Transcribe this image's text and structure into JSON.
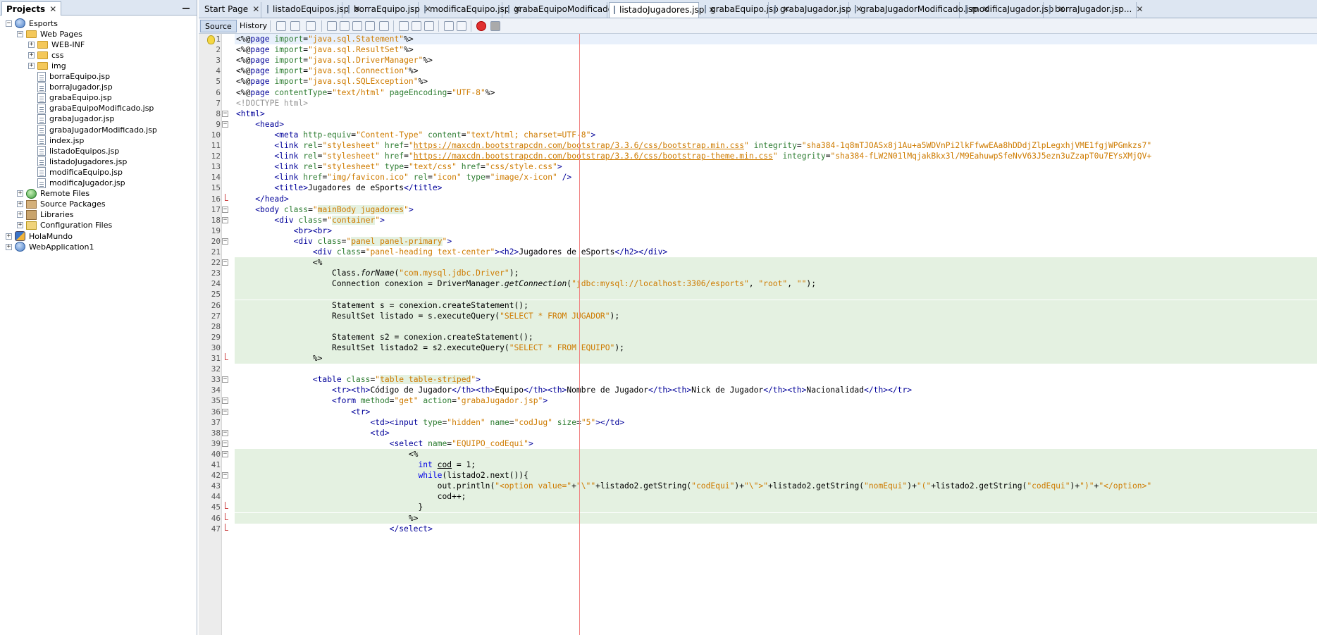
{
  "projects": {
    "tab_label": "Projects",
    "tree": [
      {
        "label": "Esports",
        "icon": "globe-icon",
        "exp": "−",
        "depth": 0
      },
      {
        "label": "Web Pages",
        "icon": "folder-icon",
        "exp": "−",
        "depth": 1
      },
      {
        "label": "WEB-INF",
        "icon": "folder-icon",
        "exp": "+",
        "depth": 2
      },
      {
        "label": "css",
        "icon": "folder-icon",
        "exp": "+",
        "depth": 2
      },
      {
        "label": "img",
        "icon": "folder-icon",
        "exp": "+",
        "depth": 2
      },
      {
        "label": "borraEquipo.jsp",
        "icon": "file-icon",
        "exp": "",
        "depth": 2
      },
      {
        "label": "borraJugador.jsp",
        "icon": "file-icon",
        "exp": "",
        "depth": 2
      },
      {
        "label": "grabaEquipo.jsp",
        "icon": "file-icon",
        "exp": "",
        "depth": 2
      },
      {
        "label": "grabaEquipoModificado.jsp",
        "icon": "file-icon",
        "exp": "",
        "depth": 2
      },
      {
        "label": "grabaJugador.jsp",
        "icon": "file-icon",
        "exp": "",
        "depth": 2
      },
      {
        "label": "grabaJugadorModificado.jsp",
        "icon": "file-icon",
        "exp": "",
        "depth": 2
      },
      {
        "label": "index.jsp",
        "icon": "file-icon",
        "exp": "",
        "depth": 2
      },
      {
        "label": "listadoEquipos.jsp",
        "icon": "file-icon",
        "exp": "",
        "depth": 2
      },
      {
        "label": "listadoJugadores.jsp",
        "icon": "file-icon",
        "exp": "",
        "depth": 2
      },
      {
        "label": "modificaEquipo.jsp",
        "icon": "file-icon",
        "exp": "",
        "depth": 2
      },
      {
        "label": "modificaJugador.jsp",
        "icon": "file-icon",
        "exp": "",
        "depth": 2
      },
      {
        "label": "Remote Files",
        "icon": "remote-globe-icon",
        "exp": "+",
        "depth": 1
      },
      {
        "label": "Source Packages",
        "icon": "package-icon",
        "exp": "+",
        "depth": 1
      },
      {
        "label": "Libraries",
        "icon": "library-icon",
        "exp": "+",
        "depth": 1
      },
      {
        "label": "Configuration Files",
        "icon": "config-folder-icon",
        "exp": "+",
        "depth": 1
      },
      {
        "label": "HolaMundo",
        "icon": "java-project-icon",
        "exp": "+",
        "depth": 0
      },
      {
        "label": "WebApplication1",
        "icon": "globe-icon",
        "exp": "+",
        "depth": 0
      }
    ]
  },
  "editor_tabs": [
    {
      "label": "Start Page",
      "active": false
    },
    {
      "label": "listadoEquipos.jsp",
      "active": false
    },
    {
      "label": "borraEquipo.jsp",
      "active": false
    },
    {
      "label": "modificaEquipo.jsp",
      "active": false
    },
    {
      "label": "grabaEquipoModificado.jsp",
      "active": false
    },
    {
      "label": "listadoJugadores.jsp",
      "active": true
    },
    {
      "label": "grabaEquipo.jsp",
      "active": false
    },
    {
      "label": "grabaJugador.jsp",
      "active": false
    },
    {
      "label": "grabaJugadorModificado.jsp",
      "active": false
    },
    {
      "label": "modificaJugador.jsp",
      "active": false
    },
    {
      "label": "borraJugador.jsp...",
      "active": false
    }
  ],
  "toolbar": {
    "source_label": "Source",
    "history_label": "History"
  },
  "code_lines": [
    {
      "n": "1",
      "html": "<span class='d'>&lt;%@</span><span class='t'>page</span> <span class='green'>import</span>=<span class='s'>\"java.sql.Statement\"</span><span class='d'>%&gt;</span>",
      "bg": "hl1"
    },
    {
      "n": "2",
      "html": "<span class='d'>&lt;%@</span><span class='t'>page</span> <span class='green'>import</span>=<span class='s'>\"java.sql.ResultSet\"</span><span class='d'>%&gt;</span>"
    },
    {
      "n": "3",
      "html": "<span class='d'>&lt;%@</span><span class='t'>page</span> <span class='green'>import</span>=<span class='s'>\"java.sql.DriverManager\"</span><span class='d'>%&gt;</span>"
    },
    {
      "n": "4",
      "html": "<span class='d'>&lt;%@</span><span class='t'>page</span> <span class='green'>import</span>=<span class='s'>\"java.sql.Connection\"</span><span class='d'>%&gt;</span>"
    },
    {
      "n": "5",
      "html": "<span class='d'>&lt;%@</span><span class='t'>page</span> <span class='green'>import</span>=<span class='s'>\"java.sql.SQLException\"</span><span class='d'>%&gt;</span>"
    },
    {
      "n": "6",
      "html": "<span class='d'>&lt;%@</span><span class='t'>page</span> <span class='green'>contentType</span>=<span class='s'>\"text/html\"</span> <span class='green'>pageEncoding</span>=<span class='s'>\"UTF-8\"</span><span class='d'>%&gt;</span>"
    },
    {
      "n": "7",
      "html": "<span class='c'>&lt;!DOCTYPE html&gt;</span>"
    },
    {
      "n": "8",
      "html": "<span class='t'>&lt;html&gt;</span>",
      "fold": "box"
    },
    {
      "n": "9",
      "html": "    <span class='t'>&lt;head&gt;</span>",
      "fold": "box"
    },
    {
      "n": "10",
      "html": "        <span class='t'>&lt;meta</span> <span class='green'>http-equiv</span>=<span class='s'>\"Content-Type\"</span> <span class='green'>content</span>=<span class='s'>\"text/html; charset=UTF-8\"</span><span class='t'>&gt;</span>"
    },
    {
      "n": "11",
      "html": "        <span class='t'>&lt;link</span> <span class='green'>rel</span>=<span class='s'>\"stylesheet\"</span> <span class='green'>href</span>=<span class='s'>\"</span><span class='u'>https://maxcdn.bootstrapcdn.com/bootstrap/3.3.6/css/bootstrap.min.css</span><span class='s'>\"</span> <span class='green'>integrity</span>=<span class='s'>\"sha384-1q8mTJOASx8j1Au+a5WDVnPi2lkFfwwEAa8hDDdjZlpLegxhjVME1fgjWPGmkzs7\"</span>"
    },
    {
      "n": "12",
      "html": "        <span class='t'>&lt;link</span> <span class='green'>rel</span>=<span class='s'>\"stylesheet\"</span> <span class='green'>href</span>=<span class='s'>\"</span><span class='u'>https://maxcdn.bootstrapcdn.com/bootstrap/3.3.6/css/bootstrap-theme.min.css</span><span class='s'>\"</span> <span class='green'>integrity</span>=<span class='s'>\"sha384-fLW2N01lMqjakBkx3l/M9EahuwpSfeNvV63J5ezn3uZzapT0u7EYsXMjQV+</span>"
    },
    {
      "n": "13",
      "html": "        <span class='t'>&lt;link</span> <span class='green'>rel</span>=<span class='s'>\"stylesheet\"</span> <span class='green'>type</span>=<span class='s'>\"text/css\"</span> <span class='green'>href</span>=<span class='s'>\"css/style.css\"</span><span class='t'>&gt;</span>"
    },
    {
      "n": "14",
      "html": "        <span class='t'>&lt;link</span> <span class='green'>href</span>=<span class='s'>\"img/favicon.ico\"</span> <span class='green'>rel</span>=<span class='s'>\"icon\"</span> <span class='green'>type</span>=<span class='s'>\"image/x-icon\"</span> <span class='t'>/&gt;</span>"
    },
    {
      "n": "15",
      "html": "        <span class='t'>&lt;title&gt;</span>Jugadores de eSports<span class='t'>&lt;/title&gt;</span>"
    },
    {
      "n": "16",
      "html": "    <span class='t'>&lt;/head&gt;</span>",
      "fold": "end"
    },
    {
      "n": "17",
      "html": "    <span class='t'>&lt;body</span> <span class='green'>class</span>=<span class='s'>\"<span class='hlg'>mainBody jugadores</span>\"</span><span class='t'>&gt;</span>",
      "fold": "box"
    },
    {
      "n": "18",
      "html": "        <span class='t'>&lt;div</span> <span class='green'>class</span>=<span class='s'>\"<span class='hlg'>container</span>\"</span><span class='t'>&gt;</span>",
      "fold": "box"
    },
    {
      "n": "19",
      "html": "            <span class='t'>&lt;br&gt;&lt;br&gt;</span>"
    },
    {
      "n": "20",
      "html": "            <span class='t'>&lt;div</span> <span class='green'>class</span>=<span class='s'>\"<span class='hlg'>panel panel-primary</span>\"</span><span class='t'>&gt;</span>",
      "fold": "box"
    },
    {
      "n": "21",
      "html": "                <span class='t'>&lt;div</span> <span class='green'>class</span>=<span class='s'>\"panel-heading text-center\"</span><span class='t'>&gt;&lt;h2&gt;</span>Jugadores de eSports<span class='t'>&lt;/h2&gt;&lt;/div&gt;</span>"
    },
    {
      "n": "22",
      "html": "                <span class='d'>&lt;%</span>",
      "fold": "box",
      "bg": "jsp"
    },
    {
      "n": "23",
      "html": "                    Class.<span style='font-style:italic'>forName</span>(<span class='s'>\"com.mysql.jdbc.Driver\"</span>);",
      "bg": "jsp"
    },
    {
      "n": "24",
      "html": "                    Connection conexion = DriverManager.<span style='font-style:italic'>getConnection</span>(<span class='s'>\"jdbc:mysql://localhost:3306/esports\"</span>, <span class='s'>\"root\"</span>, <span class='s'>\"\"</span>);",
      "bg": "jsp"
    },
    {
      "n": "25",
      "html": "",
      "bg": "jsp"
    },
    {
      "n": "26",
      "html": "                    Statement s = conexion.createStatement();",
      "bg": "jsp"
    },
    {
      "n": "27",
      "html": "                    ResultSet listado = s.executeQuery(<span class='s'>\"SELECT * FROM JUGADOR\"</span>);",
      "bg": "jsp"
    },
    {
      "n": "28",
      "html": "",
      "bg": "jsp"
    },
    {
      "n": "29",
      "html": "                    Statement s2 = conexion.createStatement();",
      "bg": "jsp"
    },
    {
      "n": "30",
      "html": "                    ResultSet listado2 = s2.executeQuery(<span class='s'>\"SELECT * FROM EQUIPO\"</span>);",
      "bg": "jsp"
    },
    {
      "n": "31",
      "html": "                <span class='d'>%&gt;</span>",
      "fold": "end",
      "bg": "jsp"
    },
    {
      "n": "32",
      "html": ""
    },
    {
      "n": "33",
      "html": "                <span class='t'>&lt;table</span> <span class='green'>class</span>=<span class='s'>\"<span class='hlg'>table table-striped</span>\"</span><span class='t'>&gt;</span>",
      "fold": "box"
    },
    {
      "n": "34",
      "html": "                    <span class='t'>&lt;tr&gt;&lt;th&gt;</span>Código de Jugador<span class='t'>&lt;/th&gt;&lt;th&gt;</span>Equipo<span class='t'>&lt;/th&gt;&lt;th&gt;</span>Nombre de Jugador<span class='t'>&lt;/th&gt;&lt;th&gt;</span>Nick de Jugador<span class='t'>&lt;/th&gt;&lt;th&gt;</span>Nacionalidad<span class='t'>&lt;/th&gt;&lt;/tr&gt;</span>"
    },
    {
      "n": "35",
      "html": "                    <span class='t'>&lt;form</span> <span class='green'>method</span>=<span class='s'>\"get\"</span> <span class='green'>action</span>=<span class='s'>\"grabaJugador.jsp\"</span><span class='t'>&gt;</span>",
      "fold": "box"
    },
    {
      "n": "36",
      "html": "                        <span class='t'>&lt;tr&gt;</span>",
      "fold": "box"
    },
    {
      "n": "37",
      "html": "                            <span class='t'>&lt;td&gt;&lt;input</span> <span class='green'>type</span>=<span class='s'>\"hidden\"</span> <span class='green'>name</span>=<span class='s'>\"codJug\"</span> <span class='green'>size</span>=<span class='s'>\"5\"</span><span class='t'>&gt;&lt;/td&gt;</span>"
    },
    {
      "n": "38",
      "html": "                            <span class='t'>&lt;td&gt;</span>",
      "fold": "box"
    },
    {
      "n": "39",
      "html": "                                <span class='t'>&lt;select</span> <span class='green'>name</span>=<span class='s'>\"EQUIPO_codEqui\"</span><span class='t'>&gt;</span>",
      "fold": "box"
    },
    {
      "n": "40",
      "html": "                                    <span class='d'>&lt;%</span>",
      "fold": "box",
      "bg": "jsp"
    },
    {
      "n": "41",
      "html": "                                      <span class='k'>int</span> <span style='text-decoration:underline'>cod</span> = 1;",
      "bg": "jsp"
    },
    {
      "n": "42",
      "html": "                                      <span class='k'>while</span>(listado2.next()){",
      "fold": "box",
      "bg": "jsp"
    },
    {
      "n": "43",
      "html": "                                          out.println(<span class='s'>\"&lt;option value=\"</span>+<span class='s'>\"\\\"\"</span>+listado2.getString(<span class='s'>\"codEqui\"</span>)+<span class='s'>\"\\\"&gt;\"</span>+listado2.getString(<span class='s'>\"nomEqui\"</span>)+<span class='s'>\"(\"</span>+listado2.getString(<span class='s'>\"codEqui\"</span>)+<span class='s'>\")\"</span>+<span class='s'>\"&lt;/option&gt;\"</span>",
      "bg": "jsp"
    },
    {
      "n": "44",
      "html": "                                          cod++;",
      "bg": "jsp"
    },
    {
      "n": "45",
      "html": "                                      }",
      "fold": "end",
      "bg": "jsp"
    },
    {
      "n": "46",
      "html": "                                    <span class='d'>%&gt;</span>",
      "fold": "end",
      "bg": "jsp"
    },
    {
      "n": "47",
      "html": "                                <span class='t'>&lt;/select&gt;</span>",
      "fold": "end"
    }
  ]
}
